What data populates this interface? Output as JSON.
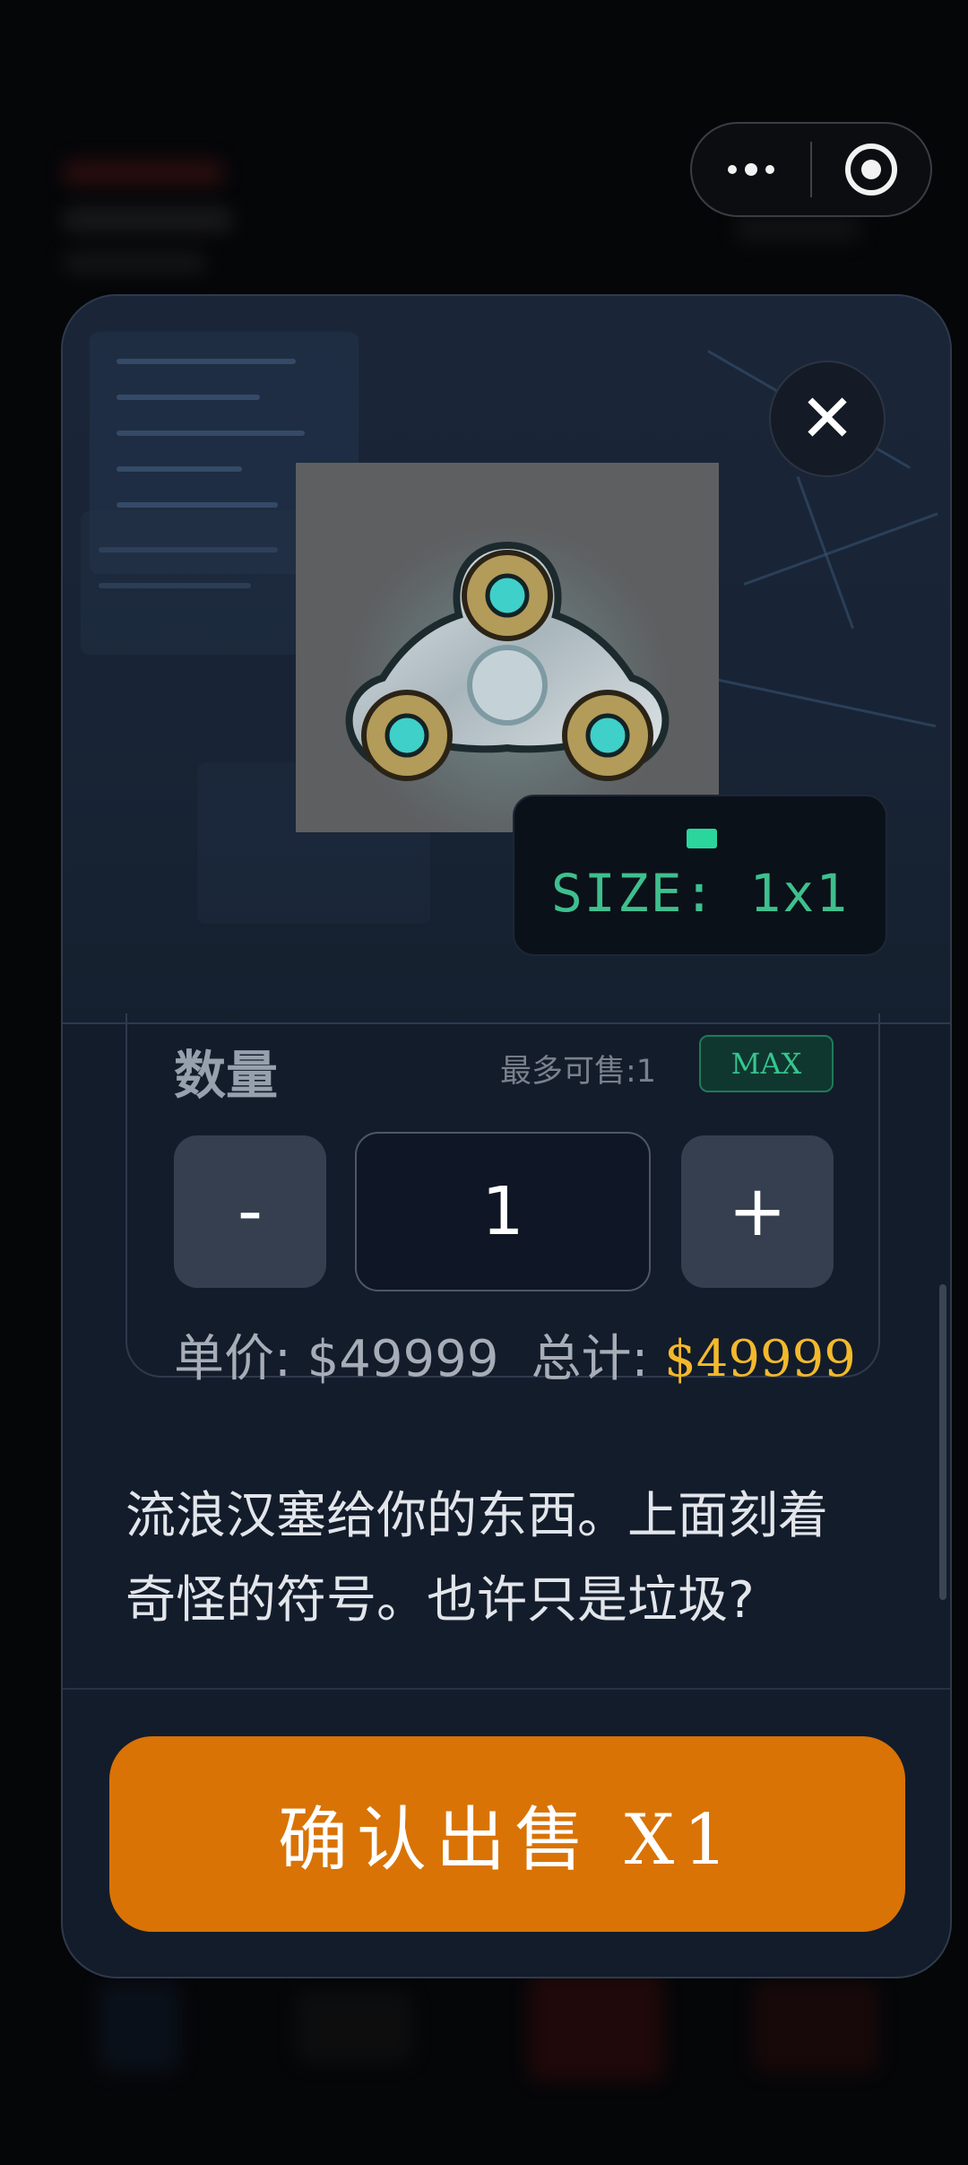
{
  "capsule": {
    "more_icon": "more-dots-icon",
    "close_icon": "target-circle-icon"
  },
  "modal": {
    "close_symbol": "✕",
    "item_image": "fidget-spinner-image",
    "size_label": "SIZE: 1x1",
    "quantity": {
      "label": "数量",
      "max_hint": "最多可售:1",
      "max_button": "MAX",
      "minus": "-",
      "value": "1",
      "plus": "+",
      "unit_price": "单价: $49999",
      "total_label": "总计:",
      "total_value": "$49999"
    },
    "description_line1": "流浪汉塞给你的东西。上面刻着",
    "description_line2": "奇怪的符号。也许只是垃圾?",
    "confirm_button": "确认出售 X1"
  },
  "colors": {
    "accent_orange": "#d97305",
    "accent_green": "#3fbf8e",
    "price_gold": "#f3b92c",
    "panel_bg": "#131c2b"
  }
}
